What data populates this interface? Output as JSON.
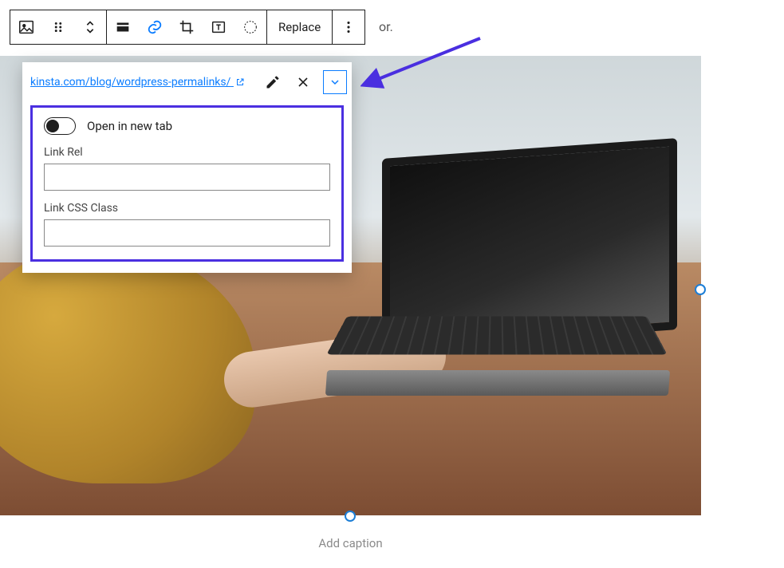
{
  "toolbar": {
    "replace_label": "Replace"
  },
  "peek_text": "or.",
  "stray_period": ".",
  "caption_placeholder": "Add caption",
  "link_popover": {
    "url": "kinsta.com/blog/wordpress-permalinks/",
    "open_new_tab_label": "Open in new tab",
    "link_rel_label": "Link Rel",
    "link_rel_value": "",
    "link_css_label": "Link CSS Class",
    "link_css_value": ""
  }
}
